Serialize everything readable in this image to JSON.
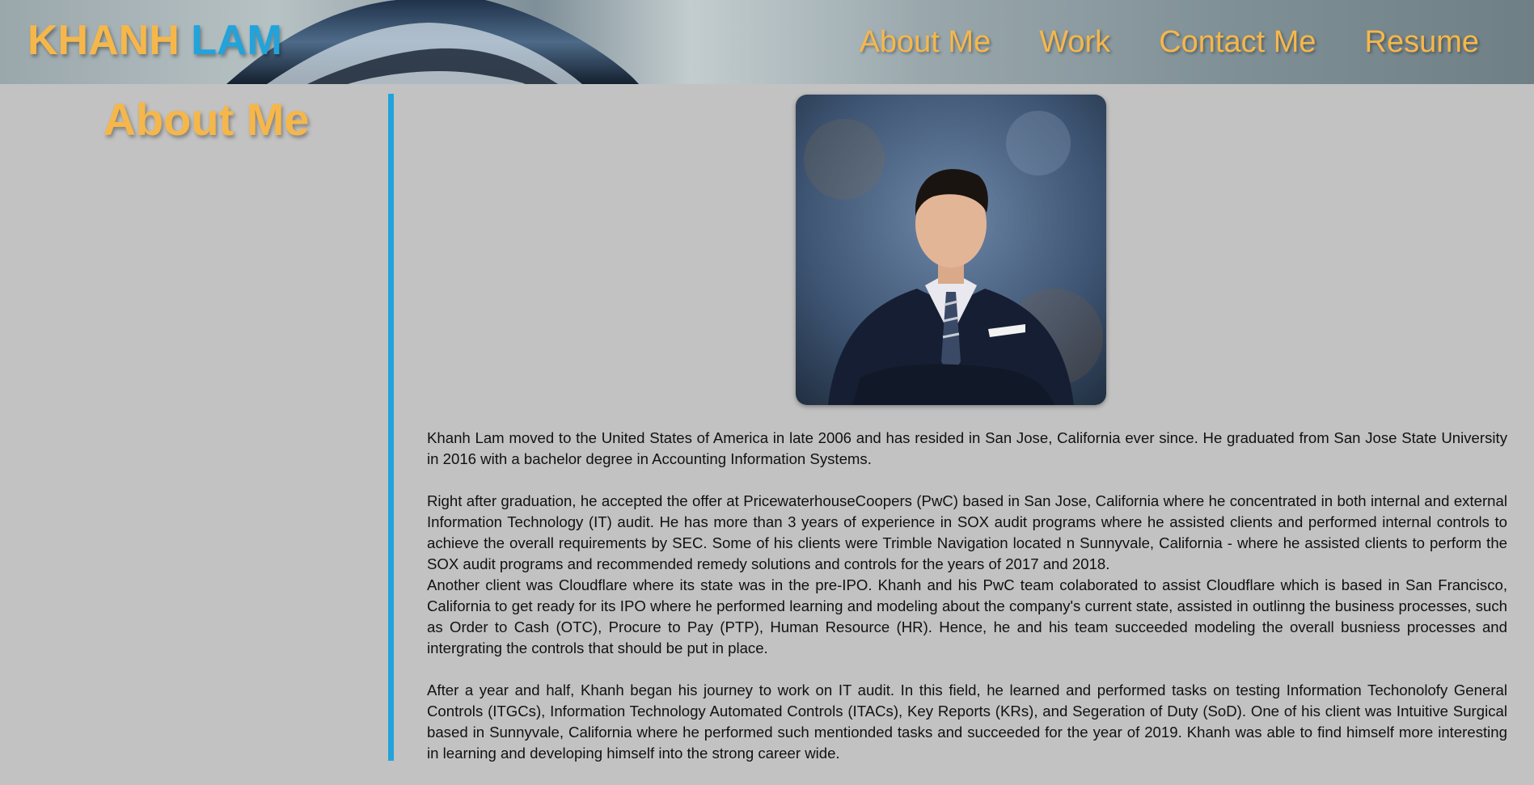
{
  "header": {
    "logo_first": "KHANH",
    "logo_last": "LAM",
    "nav": [
      "About Me",
      "Work",
      "Contact Me",
      "Resume"
    ]
  },
  "colors": {
    "accent_orange": "#f6b74a",
    "accent_blue": "#22a3db",
    "page_bg": "#c2c2c2"
  },
  "sidebar": {
    "title": "About Me"
  },
  "main": {
    "paragraphs": [
      "Khanh Lam moved to the United States of America in late 2006 and has resided in San Jose, California ever since. He graduated from San Jose State University in 2016 with a bachelor degree in Accounting Information Systems.",
      "Right after graduation, he accepted the offer at PricewaterhouseCoopers (PwC) based in San Jose, California where he concentrated in both internal and external Information Technology (IT) audit. He has more than 3 years of experience in SOX audit programs where he assisted clients and performed internal controls to achieve the overall requirements by SEC. Some of his clients were Trimble Navigation located n Sunnyvale, California - where he assisted clients to perform the SOX audit programs and recommended remedy solutions and controls for the years of 2017 and 2018.",
      "Another client was Cloudflare where its state was in the pre-IPO. Khanh and his PwC team colaborated to assist Cloudflare which is based in San Francisco, California to get ready for its IPO where he performed learning and modeling about the company's current state, assisted in outlinng the business processes, such as Order to Cash (OTC), Procure to Pay (PTP), Human Resource (HR). Hence, he and his team succeeded modeling the overall busniess processes and intergrating the controls that should be put in place.",
      "After a year and half, Khanh began his journey to work on IT audit. In this field, he learned and performed tasks on testing Information Techonolofy General Controls (ITGCs), Information Technology Automated Controls (ITACs), Key Reports (KRs), and Segeration of Duty (SoD). One of his client was Intuitive Surgical based in Sunnyvale, California where he performed such mentionded tasks and succeeded for the year of 2019. Khanh was able to find himself more interesting in learning and developing himself into the strong career wide."
    ]
  }
}
